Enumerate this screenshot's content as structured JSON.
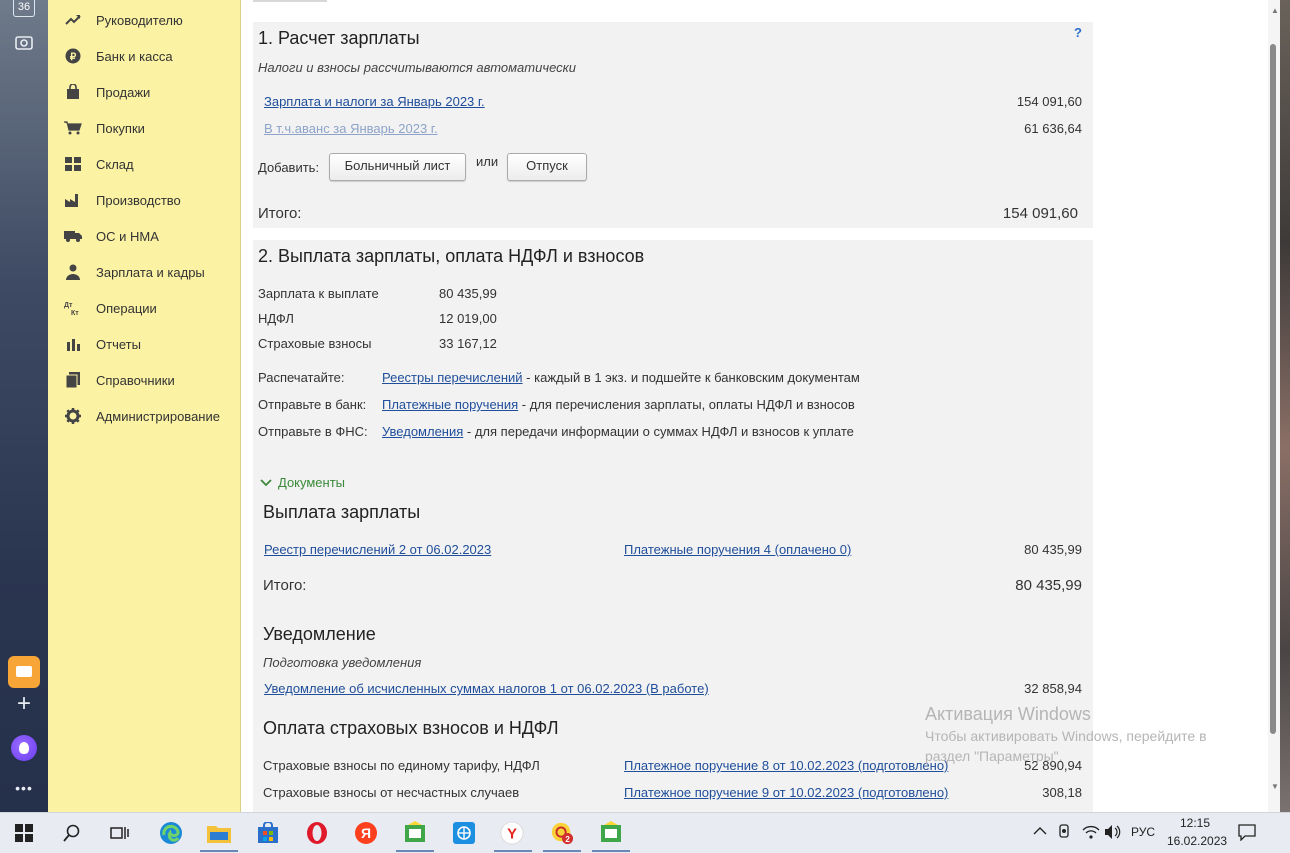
{
  "leftbar": {
    "badge": "36"
  },
  "sidebar": {
    "items": [
      {
        "label": "Руководителю",
        "icon": "trend-up-icon"
      },
      {
        "label": "Банк и касса",
        "icon": "ruble-icon"
      },
      {
        "label": "Продажи",
        "icon": "shopping-bag-icon"
      },
      {
        "label": "Покупки",
        "icon": "cart-icon"
      },
      {
        "label": "Склад",
        "icon": "warehouse-grid-icon"
      },
      {
        "label": "Производство",
        "icon": "factory-icon"
      },
      {
        "label": "ОС и НМА",
        "icon": "truck-icon"
      },
      {
        "label": "Зарплата и кадры",
        "icon": "person-icon"
      },
      {
        "label": "Операции",
        "icon": "debit-credit-icon"
      },
      {
        "label": "Отчеты",
        "icon": "bar-chart-icon"
      },
      {
        "label": "Справочники",
        "icon": "books-icon"
      },
      {
        "label": "Администрирование",
        "icon": "gear-icon"
      }
    ]
  },
  "section1": {
    "title": "1. Расчет зарплаты",
    "help": "?",
    "subtitle": "Налоги и взносы рассчитываются автоматически",
    "link_salary": "Зарплата и налоги за Январь 2023 г.",
    "salary_value": "154 091,60",
    "link_advance": "В т.ч.аванс за Январь 2023 г.",
    "advance_value": "61 636,64",
    "add_label": "Добавить:",
    "sick_button": "Больничный лист",
    "or_label": "или",
    "vacation_button": "Отпуск",
    "total_label": "Итого:",
    "total_value": "154 091,60"
  },
  "section2": {
    "title": "2. Выплата зарплаты, оплата НДФЛ и взносов",
    "rows": [
      {
        "label": "Зарплата к выплате",
        "value": "80 435,99"
      },
      {
        "label": "НДФЛ",
        "value": "12 019,00"
      },
      {
        "label": "Страховые взносы",
        "value": "33 167,12"
      }
    ],
    "print_label": "Распечатайте:",
    "print_link": "Реестры перечислений",
    "print_text": " - каждый в 1 экз. и подшейте к банковским документам",
    "bank_label": "Отправьте в банк:",
    "bank_link": "Платежные поручения",
    "bank_text": " - для перечисления зарплаты, оплаты НДФЛ и взносов",
    "fns_label": "Отправьте в ФНС:",
    "fns_link": "Уведомления",
    "fns_text": " - для передачи информации о суммах НДФЛ и взносов к уплате",
    "documents_toggle": "Документы"
  },
  "payout": {
    "title": "Выплата зарплаты",
    "registry_link": "Реестр перечислений 2 от 06.02.2023",
    "orders_link": "Платежные поручения 4 (оплачено 0)",
    "value": "80 435,99",
    "total_label": "Итого:",
    "total_value": "80 435,99"
  },
  "notice": {
    "title": "Уведомление",
    "subtitle": "Подготовка уведомления",
    "link": "Уведомление об исчисленных суммах налогов 1 от 06.02.2023 (В работе)",
    "value": "32 858,94"
  },
  "insurance": {
    "title": "Оплата страховых взносов и НДФЛ",
    "rows": [
      {
        "label": "Страховые взносы по единому тарифу, НДФЛ",
        "link": "Платежное поручение 8 от 10.02.2023 (подготовлено)",
        "value": "52 890,94"
      },
      {
        "label": "Страховые взносы от несчастных случаев",
        "link": "Платежное поручение 9 от 10.02.2023 (подготовлено)",
        "value": "308,18"
      }
    ]
  },
  "watermark": {
    "line1": "Активация Windows",
    "line2": "Чтобы активировать Windows, перейдите в",
    "line3": "раздел \"Параметры\"."
  },
  "taskbar": {
    "lang": "РУС",
    "time": "12:15",
    "date": "16.02.2023",
    "badge": "2"
  }
}
